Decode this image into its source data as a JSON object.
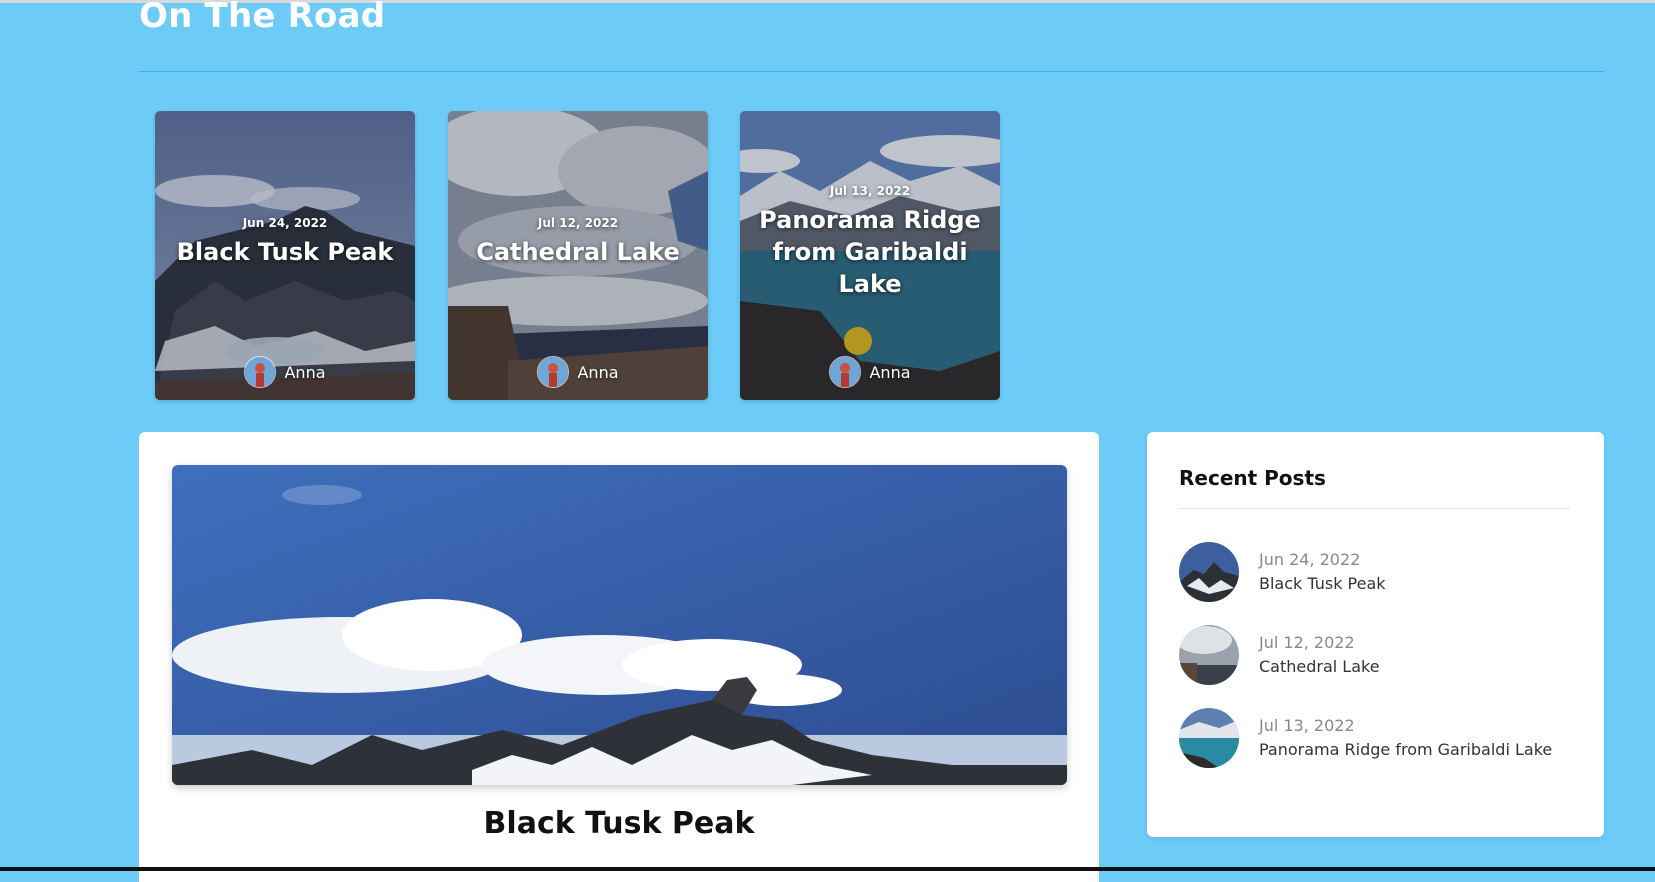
{
  "site": {
    "title": "On The Road"
  },
  "featured": [
    {
      "date": "Jun 24, 2022",
      "title": "Black Tusk Peak",
      "author": "Anna"
    },
    {
      "date": "Jul 12, 2022",
      "title": "Cathedral Lake",
      "author": "Anna"
    },
    {
      "date": "Jul 13, 2022",
      "title": "Panorama Ridge from Garibaldi Lake",
      "author": "Anna"
    }
  ],
  "main_post": {
    "title": "Black Tusk Peak"
  },
  "sidebar": {
    "heading": "Recent Posts",
    "items": [
      {
        "date": "Jun 24, 2022",
        "title": "Black Tusk Peak"
      },
      {
        "date": "Jul 12, 2022",
        "title": "Cathedral Lake"
      },
      {
        "date": "Jul 13, 2022",
        "title": "Panorama Ridge from Garibaldi Lake"
      }
    ]
  },
  "colors": {
    "page_background": "#6ccbf7",
    "divider": "#45a7f0",
    "panel": "#ffffff"
  }
}
